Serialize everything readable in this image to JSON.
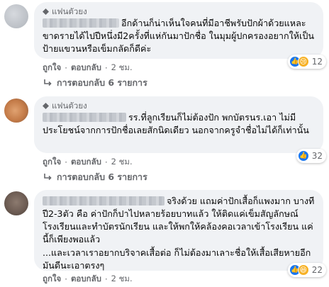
{
  "comments": [
    {
      "badge": "แฟนตัวยง",
      "text": "อีกด้านก็น่าเห็นใจคนที่มีอาชีพรับปักผ้าด้วยแหละ ขาดรายได้ไปปีหนึ่งมี2ครั้งที่แห่กันมาปักชื่อ ในมุมผู้ปกครองอยากให้เป็นป้ายแขวนหรือเข็มกลัดก็ดีค่ะ",
      "actions": {
        "like": "ถูกใจ",
        "reply": "ตอบกลับ",
        "time": "2 ชม."
      },
      "reaction_icons": [
        "like-icon",
        "sad-icon"
      ],
      "reaction_count": "12",
      "replies_label": "การตอบกลับ 6 รายการ"
    },
    {
      "badge": "แฟนตัวยง",
      "text": "รร.ที่ลูกเรียนก็ไม่ต้องปัก พกบัตรนร.เอา ไม่มีประโยชน์จากการปักชื่อเลยสักนิดเดียว นอกจากครูจำชื่อไม่ได้ก็เท่านั้น",
      "actions": {
        "like": "ถูกใจ",
        "reply": "ตอบกลับ",
        "time": "2 ชม."
      },
      "reaction_icons": [
        "like-icon"
      ],
      "reaction_count": "32",
      "replies_label": "การตอบกลับ 6 รายการ"
    },
    {
      "text": "จริงด้วย แถมค่าปักเสื้อก็แพงมาก บางทีปี2-3ตัว คือ ค่าปักก็ปาไปหลายร้อยบาทแล้ว ให้ติดแค่เข็มสัญลักษณ์โรงเรียนและทำบัตรนักเรียน และให้พกให้คล้องคอเวลาเข้าโรงเรียน แค่นี้ก็เพียงพอแล้ว",
      "text2": "...และเวลาเราอยากบริจาคเสื้อต่อ ก็ไม่ต้องมาเลาะชื่อให้เสื้อเสียหายอีก มันดีนะเอาตรงๆ",
      "actions": {
        "like": "ถูกใจ",
        "reply": "ตอบกลับ",
        "time": "2 ชม."
      },
      "reaction_icons": [
        "like-icon",
        "haha-icon"
      ],
      "reaction_count": "22"
    }
  ],
  "colors": {
    "bubble": "#f0f2f5",
    "like_blue": "#1877f2",
    "emoji_yellow": "#f7b125",
    "meta_gray": "#65676b"
  }
}
